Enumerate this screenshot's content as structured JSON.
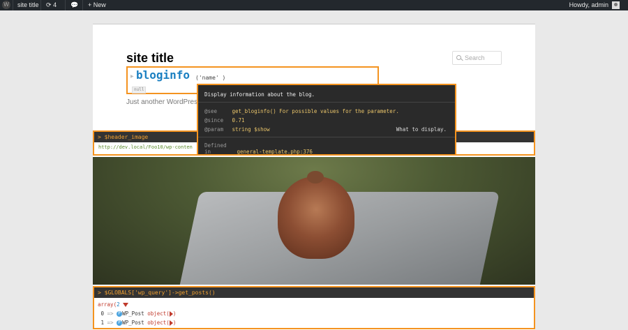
{
  "adminbar": {
    "site_title": "site title",
    "updates_count": "4",
    "new_label": "New",
    "greeting": "Howdy, admin"
  },
  "page": {
    "site_title": "site title",
    "description": "Just another WordPress s",
    "search_placeholder": "Search"
  },
  "bloginfo": {
    "function": "bloginfo",
    "args": "('name' )",
    "result": "null"
  },
  "tooltip": {
    "description": "Display information about the blog.",
    "see_key": "@see",
    "see_value": "get_bloginfo() For possible values for the parameter.",
    "since_key": "@since",
    "since_value": "0.71",
    "param_key": "@param",
    "param_value": "string $show",
    "param_desc": "What to display.",
    "defined_key": "Defined in",
    "defined_value": "general-template.php:376"
  },
  "header_image": {
    "expr": "> $header_image",
    "url": "http://dev.local/Foo10/wp-conten"
  },
  "posts": {
    "expr": "> $GLOBALS['wp_query']->get_posts()",
    "array_label": "array(",
    "array_count": "2",
    "rows": [
      {
        "index": "0",
        "arrow": "=>",
        "badge": "P",
        "class": "WP_Post",
        "type": "object("
      },
      {
        "index": "1",
        "arrow": "=>",
        "badge": "P",
        "class": "WP_Post",
        "type": "object("
      }
    ]
  },
  "colors": {
    "accent": "#f4931f",
    "function_blue": "#1a7fc1",
    "tooltip_bg": "#2a2a2a"
  }
}
